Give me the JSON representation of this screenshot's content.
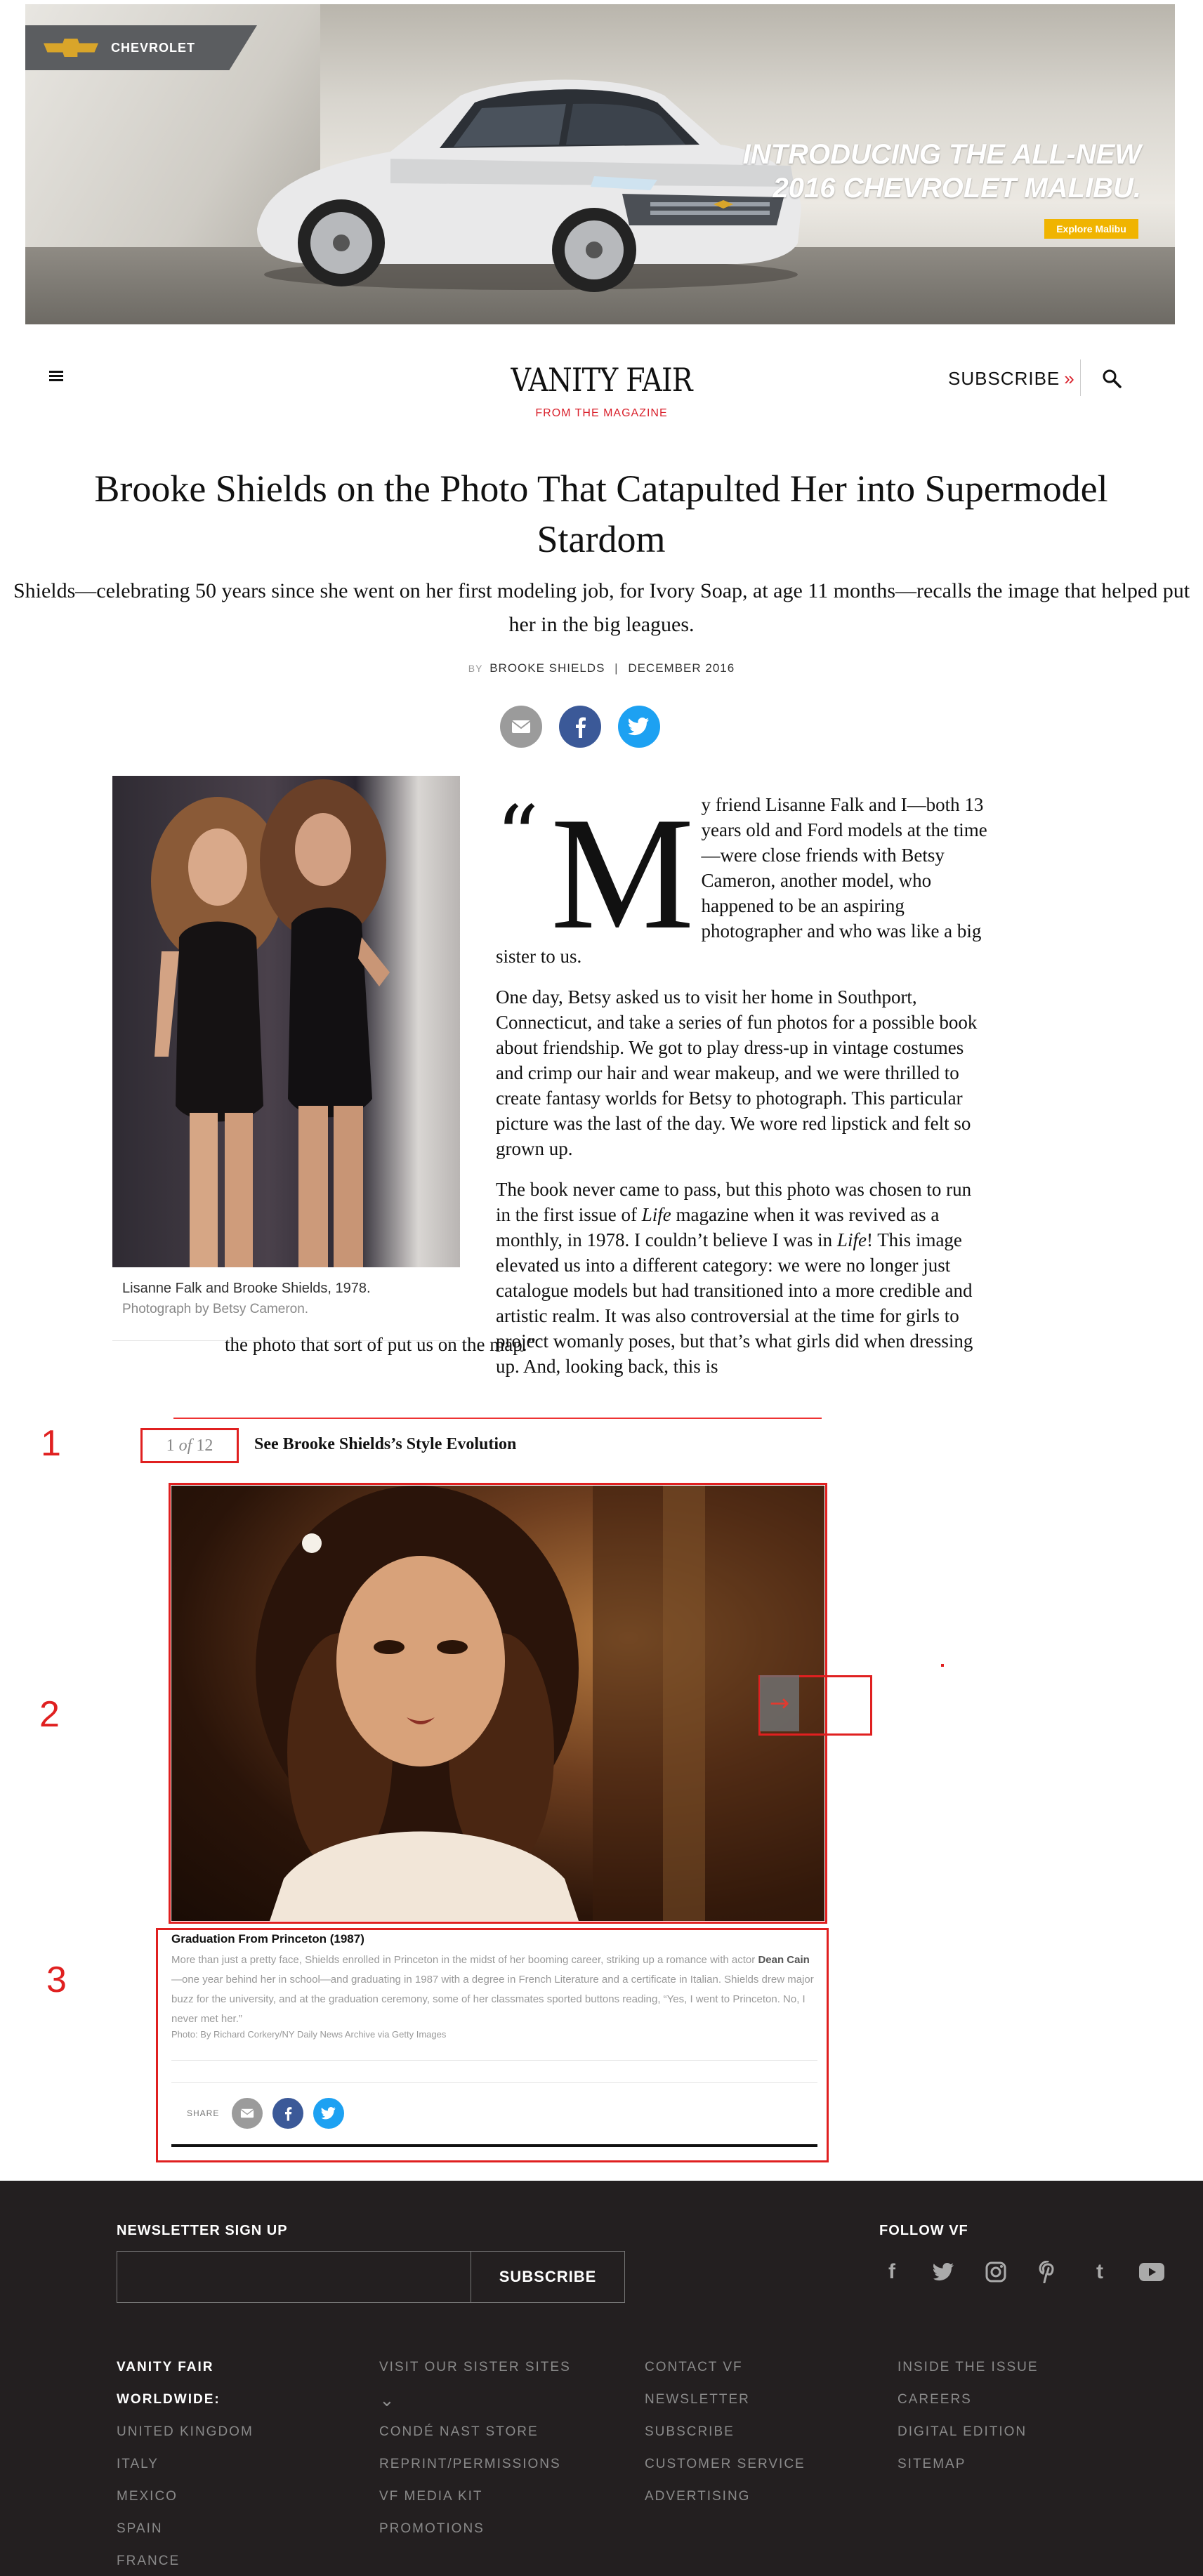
{
  "ad": {
    "brand": "CHEVROLET",
    "headline_1": "INTRODUCING THE ALL-NEW",
    "headline_2": "2016 CHEVROLET MALIBU.",
    "cta": "Explore Malibu"
  },
  "header": {
    "logo": "VANITY FAIR",
    "section": "FROM THE MAGAZINE",
    "subscribe": "SUBSCRIBE",
    "subscribe_chevron": "»"
  },
  "article": {
    "title": "Brooke Shields on the Photo That Catapulted Her into Supermodel Stardom",
    "dek": "Shields—celebrating 50 years since she went on her first modeling job, for Ivory Soap, at age 11 months—recalls the image that helped put her in the big leagues.",
    "by": "BY",
    "author": "BROOKE SHIELDS",
    "date": "DECEMBER 2016",
    "open_quote": "“",
    "dropcap": "M",
    "p1": "y friend Lisanne Falk and I—both 13 years old and Ford models at the time—were close friends with Betsy Cameron, another model, who happened to be an aspiring photographer and who was like a big sister to us.",
    "p2": "One day, Betsy asked us to visit her home in Southport, Connecticut, and take a series of fun photos for a possible book about friendship. We got to play dress-up in vintage costumes and crimp our hair and wear makeup, and we were thrilled to create fantasy worlds for Betsy to photograph. This particular picture was the last of the day. We wore red lipstick and felt so grown up.",
    "p3_a": "The book never came to pass, but this photo was chosen to run in the first issue of ",
    "p3_life1": "Life",
    "p3_b": " magazine when it was revived as a monthly, in 1978. I couldn’t believe I was in ",
    "p3_life2": "Life",
    "p3_c": "! This image elevated us into a different category: we were no longer just catalogue models but had transitioned into a more credible and artistic realm. It was also controversial at the time for girls to project womanly poses, but that’s what girls did when dressing up. And, looking back, this is",
    "p3_end": "the photo that sort of put us on the map.”",
    "photo_caption": "Lisanne Falk and Brooke Shields, 1978.",
    "photo_credit": "Photograph by Betsy Cameron."
  },
  "gallery": {
    "current": "1",
    "of": "of",
    "total": "12",
    "title": "See Brooke Shields’s Style Evolution",
    "next_arrow": "→",
    "caption_title": "Graduation From Princeton (1987)",
    "caption_a": "More than just a pretty face, Shields enrolled in Princeton in the midst of her booming career, striking up a romance with actor ",
    "caption_name": "Dean Cain",
    "caption_b": "—one year behind her in school—and graduating in 1987 with a degree in French Literature and a certificate in Italian. Shields drew major buzz for the university, and at the graduation ceremony, some of her classmates sported buttons reading, “Yes, I went to Princeton. No, I never met her.”",
    "caption_credit": "Photo: By Richard Corkery/NY Daily News Archive via Getty Images",
    "share_label": "SHARE"
  },
  "annotations": [
    "1",
    "2",
    "3"
  ],
  "footer": {
    "newsletter_heading": "NEWSLETTER SIGN UP",
    "newsletter_button": "SUBSCRIBE",
    "follow_heading": "FOLLOW VF",
    "social_icons": [
      "facebook-icon",
      "twitter-icon",
      "instagram-icon",
      "pinterest-icon",
      "tumblr-icon",
      "youtube-icon"
    ],
    "col1": [
      "VANITY FAIR",
      "WORLDWIDE:",
      "UNITED KINGDOM",
      "ITALY",
      "MEXICO",
      "SPAIN",
      "FRANCE"
    ],
    "col2": [
      "VISIT OUR SISTER SITES",
      "⌄",
      "CONDÉ NAST STORE",
      "REPRINT/PERMISSIONS",
      "VF MEDIA KIT",
      "PROMOTIONS"
    ],
    "col3": [
      "CONTACT VF",
      "NEWSLETTER",
      "SUBSCRIBE",
      "CUSTOMER SERVICE",
      "ADVERTISING"
    ],
    "col4": [
      "INSIDE THE ISSUE",
      "CAREERS",
      "DIGITAL EDITION",
      "SITEMAP"
    ]
  },
  "colors": {
    "accent_red": "#d9202b",
    "annotation_red": "#e02020",
    "facebook": "#3b5998",
    "twitter": "#1da1f2",
    "footer_bg": "#231f20"
  }
}
